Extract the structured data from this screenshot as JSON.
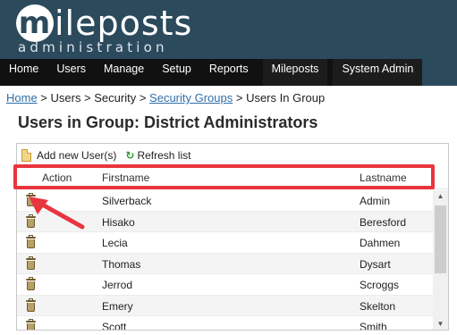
{
  "header": {
    "logo_initial": "m",
    "logo_rest": "ileposts",
    "logo_subtitle": "administration"
  },
  "nav": {
    "items": [
      "Home",
      "Users",
      "Manage",
      "Setup",
      "Reports",
      "Mileposts",
      "System Admin"
    ]
  },
  "breadcrumb": {
    "home": "Home",
    "sep1": " > Users > Security > ",
    "security_groups": "Security Groups",
    "sep2": " > Users In Group"
  },
  "page": {
    "title": "Users in Group: District Administrators"
  },
  "toolbar": {
    "add_label": "Add new User(s)",
    "refresh_label": "Refresh list"
  },
  "table": {
    "headers": {
      "action": "Action",
      "firstname": "Firstname",
      "lastname": "Lastname"
    },
    "rows": [
      {
        "firstname": "Silverback",
        "lastname": "Admin"
      },
      {
        "firstname": "Hisako",
        "lastname": "Beresford"
      },
      {
        "firstname": "Lecia",
        "lastname": "Dahmen"
      },
      {
        "firstname": "Thomas",
        "lastname": "Dysart"
      },
      {
        "firstname": "Jerrod",
        "lastname": "Scroggs"
      },
      {
        "firstname": "Emery",
        "lastname": "Skelton"
      },
      {
        "firstname": "Scott",
        "lastname": "Smith"
      }
    ]
  },
  "icons": {
    "trash": "trash-icon",
    "add": "add-document-icon",
    "refresh": "refresh-icon",
    "scroll_up": "scroll-up-arrow-icon",
    "scroll_down": "scroll-down-arrow-icon"
  },
  "colors": {
    "header_bg": "#2b4a5c",
    "nav_bg": "#111111",
    "link": "#2f6fa8",
    "annotation": "#e8353f"
  }
}
